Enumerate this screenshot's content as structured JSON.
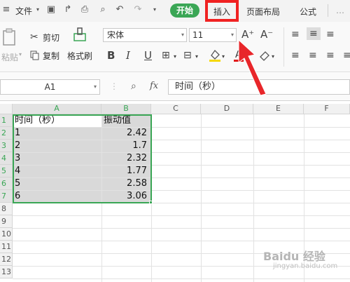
{
  "menubar": {
    "file_label": "文件",
    "tabs": [
      "开始",
      "插入",
      "页面布局",
      "公式"
    ]
  },
  "ribbon": {
    "paste_label": "粘贴",
    "cut_label": "剪切",
    "copy_label": "复制",
    "format_painter_label": "格式刷",
    "font_name": "宋体",
    "font_size": "11",
    "bold": "B",
    "italic": "I",
    "underline": "U",
    "increase_font": "A⁺",
    "decrease_font": "A⁻"
  },
  "formula_bar": {
    "cell_ref": "A1",
    "fx_label": "fx",
    "formula": "时间（秒）"
  },
  "sheet": {
    "columns": [
      "A",
      "B",
      "C",
      "D",
      "E",
      "F"
    ],
    "rows": [
      "1",
      "2",
      "3",
      "4",
      "5",
      "6",
      "7",
      "8",
      "9",
      "10",
      "11",
      "12",
      "13"
    ],
    "data": [
      [
        "时间（秒）",
        "振动值"
      ],
      [
        "1",
        "2.42"
      ],
      [
        "2",
        "1.7"
      ],
      [
        "3",
        "2.32"
      ],
      [
        "4",
        "1.77"
      ],
      [
        "5",
        "2.58"
      ],
      [
        "6",
        "3.06"
      ]
    ]
  },
  "watermark": {
    "brand": "Baidu 经验",
    "url": "jingyan.baidu.com"
  },
  "colors": {
    "accent_green": "#3aa655",
    "highlight_red": "#f02222"
  }
}
